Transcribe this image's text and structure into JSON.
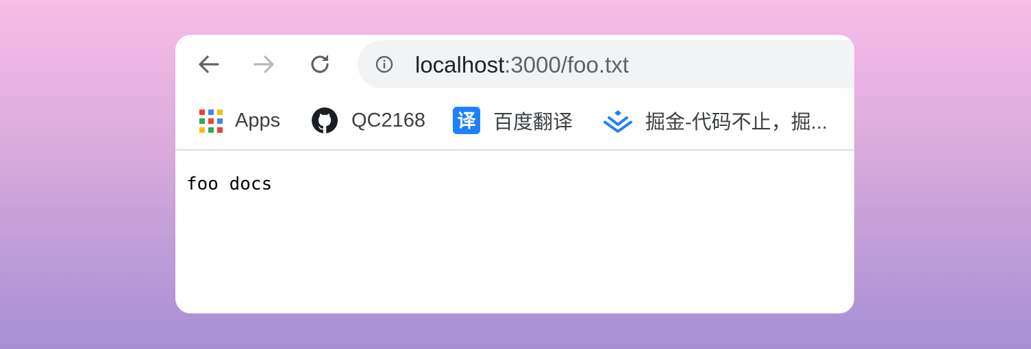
{
  "browser": {
    "address_bar": {
      "host": "localhost",
      "path": ":3000/foo.txt"
    },
    "bookmarks": [
      {
        "label": "Apps",
        "icon": "apps-grid-icon"
      },
      {
        "label": "QC2168",
        "icon": "github-icon"
      },
      {
        "label": "百度翻译",
        "icon": "baidu-translate-icon",
        "icon_text": "译"
      },
      {
        "label": "掘金-代码不止，掘...",
        "icon": "juejin-icon"
      }
    ],
    "colors": {
      "accent_blue": "#1e80ff",
      "omnibox_bg": "#f1f3f4",
      "icon_gray": "#5f6368",
      "icon_disabled": "#b7b9bc"
    }
  },
  "page": {
    "text": "foo docs"
  }
}
